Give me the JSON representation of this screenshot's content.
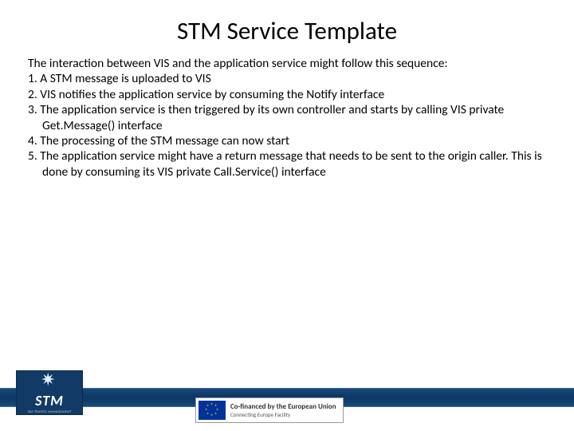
{
  "title": "STM Service Template",
  "intro": "The interaction between VIS and the application service might follow this sequence:",
  "steps": [
    "1. A STM message is uploaded to VIS",
    "2. VIS notifies the application service by consuming the Notify interface",
    "3. The application service is then triggered by its own controller and starts by calling VIS private Get.Message() interface",
    "4. The processing of the STM message can now start",
    "5. The application service might have a return message that needs to be sent to the origin caller. This is done by consuming its VIS private Call.Service() interface"
  ],
  "stm_logo": {
    "main": "STM",
    "sub": "SEA TRAFFIC MANAGEMENT"
  },
  "eu_badge": {
    "line1": "Co-financed by the European Union",
    "line2": "Connecting Europe Facility"
  }
}
